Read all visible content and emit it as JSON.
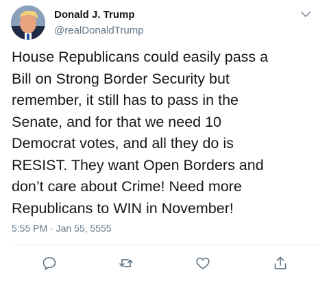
{
  "tweet": {
    "author_name": "Donald J. Trump",
    "author_handle": "@realDonaldTrump",
    "text": "House Republicans could easily pass a\nBill on Strong Border Security but\nremember, it still has to pass in the\nSenate, and for that we need 10\nDemocrat votes, and all they do is\nRESIST. They want Open Borders and\ndon’t care about Crime! Need more\nRepublicans to WIN in November!",
    "timestamp": "5:55 PM · Jan 55, 5555"
  },
  "icons": {
    "menu": "chevron-down-icon",
    "reply": "reply-icon",
    "retweet": "retweet-icon",
    "like": "heart-icon",
    "share": "share-icon"
  },
  "colors": {
    "text": "#14171a",
    "secondary": "#657786",
    "divider": "#e1e8ed",
    "icon": "#657786"
  }
}
